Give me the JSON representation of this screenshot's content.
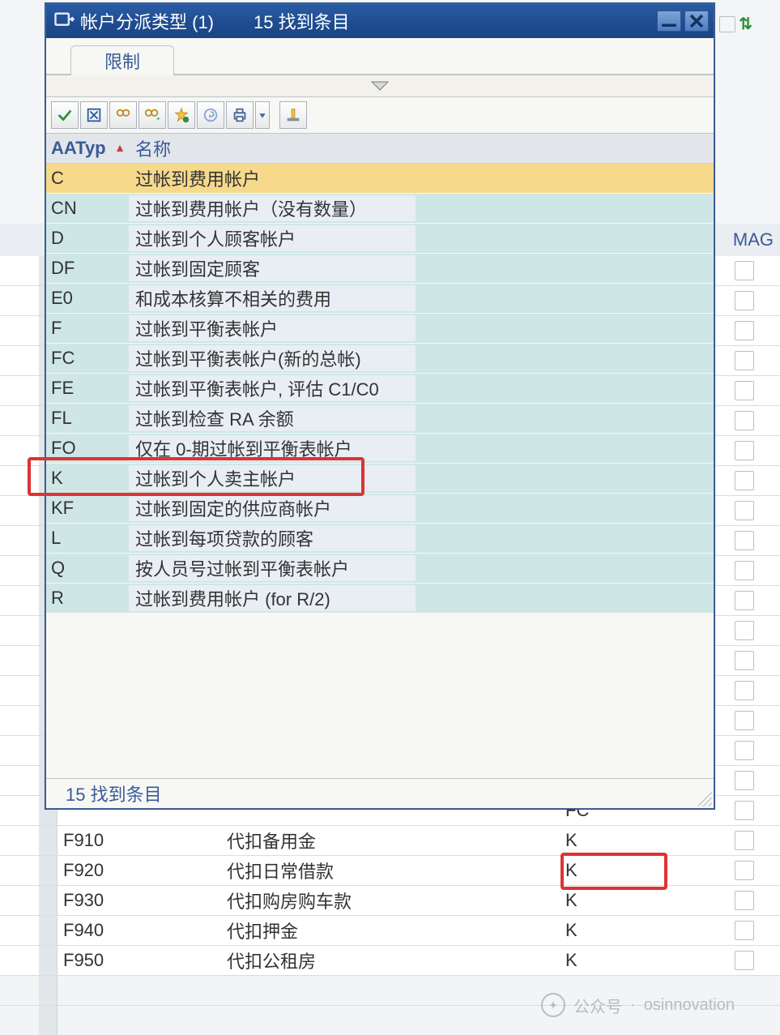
{
  "dialog": {
    "title": "帐户分派类型 (1)",
    "count_text": "15 找到条目",
    "tab": "限制",
    "footer": "15 找到条目",
    "columns": {
      "aatyp": "AATyp",
      "name": "名称"
    },
    "rows": [
      {
        "aatyp": "C",
        "name": "过帐到费用帐户",
        "selected": true
      },
      {
        "aatyp": "CN",
        "name": "过帐到费用帐户（没有数量）"
      },
      {
        "aatyp": "D",
        "name": "过帐到个人顾客帐户"
      },
      {
        "aatyp": "DF",
        "name": "过帐到固定顾客"
      },
      {
        "aatyp": "E0",
        "name": "和成本核算不相关的费用"
      },
      {
        "aatyp": "F",
        "name": "过帐到平衡表帐户"
      },
      {
        "aatyp": "FC",
        "name": "过帐到平衡表帐户(新的总帐)"
      },
      {
        "aatyp": "FE",
        "name": "过帐到平衡表帐户, 评估 C1/C0"
      },
      {
        "aatyp": "FL",
        "name": "过帐到检查 RA 余额"
      },
      {
        "aatyp": "FO",
        "name": "仅在 0-期过帐到平衡表帐户"
      },
      {
        "aatyp": "K",
        "name": "过帐到个人卖主帐户",
        "highlight": true
      },
      {
        "aatyp": "KF",
        "name": "过帐到固定的供应商帐户"
      },
      {
        "aatyp": "L",
        "name": "过帐到每项贷款的顾客"
      },
      {
        "aatyp": "Q",
        "name": "按人员号过帐到平衡表帐户"
      },
      {
        "aatyp": "R",
        "name": "过帐到费用帐户 (for R/2)"
      }
    ]
  },
  "bg_header": {
    "mag": "MAG"
  },
  "bg_rows": [
    {
      "code": "F910",
      "desc": "代扣备用金",
      "aat": "K"
    },
    {
      "code": "F920",
      "desc": "代扣日常借款",
      "aat": "K",
      "highlight": true
    },
    {
      "code": "F930",
      "desc": "代扣购房购车款",
      "aat": "K"
    },
    {
      "code": "F940",
      "desc": "代扣押金",
      "aat": "K"
    },
    {
      "code": "F950",
      "desc": "代扣公租房",
      "aat": "K"
    }
  ],
  "bg_hidden_top": {
    "aat": "FC"
  },
  "watermark": {
    "label": "公众号",
    "source": "osinnovation"
  }
}
